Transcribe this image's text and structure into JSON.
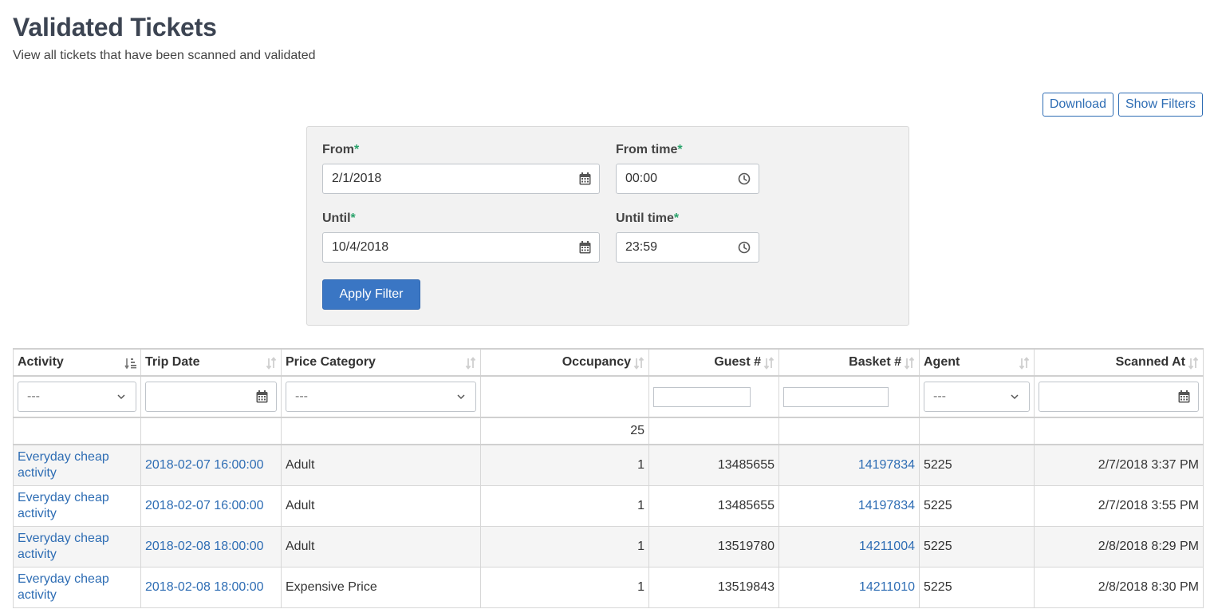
{
  "page": {
    "title": "Validated Tickets",
    "subtitle": "View all tickets that have been scanned and validated"
  },
  "actions": {
    "download_label": "Download",
    "show_filters_label": "Show Filters"
  },
  "filters": {
    "from_label": "From",
    "from_value": "2/1/2018",
    "from_time_label": "From time",
    "from_time_value": "00:00",
    "until_label": "Until",
    "until_value": "10/4/2018",
    "until_time_label": "Until time",
    "until_time_value": "23:59",
    "required_marker": "*",
    "apply_label": "Apply Filter"
  },
  "table": {
    "columns": [
      "Activity",
      "Trip Date",
      "Price Category",
      "Occupancy",
      "Guest #",
      "Basket #",
      "Agent",
      "Scanned At"
    ],
    "select_placeholder": "---",
    "occupancy_total": "25",
    "rows": [
      {
        "activity": "Everyday cheap activity",
        "trip_date": "2018-02-07 16:00:00",
        "price_category": "Adult",
        "occupancy": "1",
        "guest": "13485655",
        "basket": "14197834",
        "agent": "5225",
        "scanned_at": "2/7/2018 3:37 PM"
      },
      {
        "activity": "Everyday cheap activity",
        "trip_date": "2018-02-07 16:00:00",
        "price_category": "Adult",
        "occupancy": "1",
        "guest": "13485655",
        "basket": "14197834",
        "agent": "5225",
        "scanned_at": "2/7/2018 3:55 PM"
      },
      {
        "activity": "Everyday cheap activity",
        "trip_date": "2018-02-08 18:00:00",
        "price_category": "Adult",
        "occupancy": "1",
        "guest": "13519780",
        "basket": "14211004",
        "agent": "5225",
        "scanned_at": "2/8/2018 8:29 PM"
      },
      {
        "activity": "Everyday cheap activity",
        "trip_date": "2018-02-08 18:00:00",
        "price_category": "Expensive Price",
        "occupancy": "1",
        "guest": "13519843",
        "basket": "14211010",
        "agent": "5225",
        "scanned_at": "2/8/2018 8:30 PM"
      }
    ]
  },
  "icons": {
    "calendar": "calendar-icon",
    "clock": "clock-icon",
    "chevron": "chevron-down-icon",
    "sort": "sort-icon",
    "sort_active": "sort-active-icon"
  },
  "colors": {
    "accent": "#2e6db4",
    "primary_button": "#3a76c4",
    "required": "#2aa36b",
    "title": "#3c4452"
  }
}
